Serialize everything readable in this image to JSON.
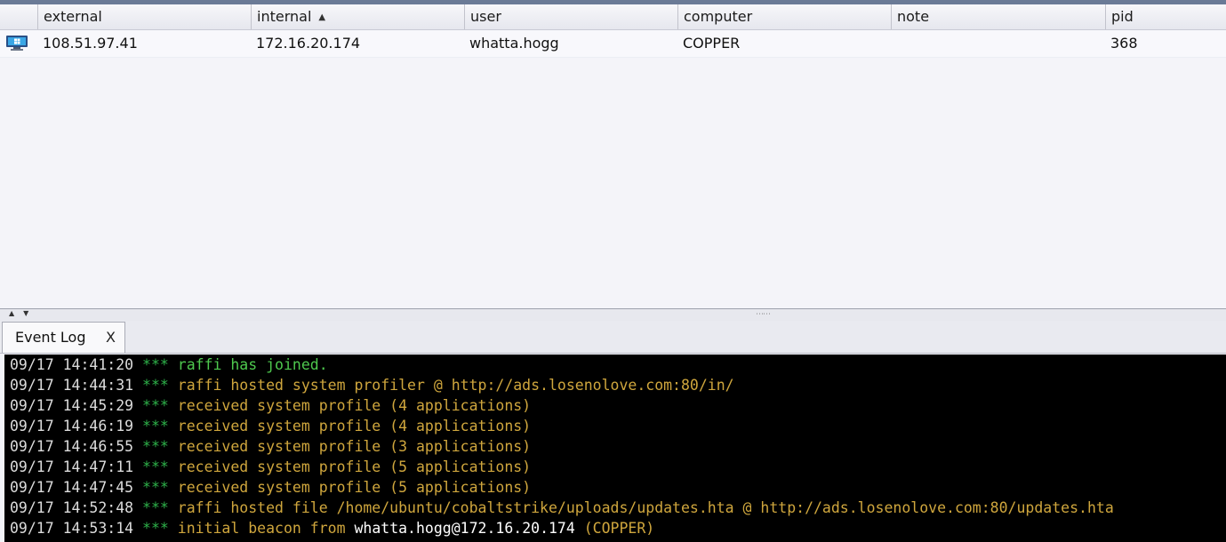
{
  "table": {
    "columns": [
      {
        "label": "external"
      },
      {
        "label": "internal",
        "sort": "▲"
      },
      {
        "label": "user"
      },
      {
        "label": "computer"
      },
      {
        "label": "note"
      },
      {
        "label": "pid"
      }
    ],
    "rows": [
      {
        "icon": "windows-monitor-icon",
        "external": "108.51.97.41",
        "internal": "172.16.20.174",
        "user": "whatta.hogg",
        "computer": "COPPER",
        "note": "",
        "pid": "368"
      }
    ]
  },
  "tabs": [
    {
      "label": "Event Log",
      "close": "X"
    }
  ],
  "event_log": [
    {
      "time": "09/17 14:41:20",
      "stars": "***",
      "msg": "raffi has joined.",
      "style": "green"
    },
    {
      "time": "09/17 14:44:31",
      "stars": "***",
      "msg": "raffi hosted system profiler @ http://ads.losenolove.com:80/in/",
      "style": "amber"
    },
    {
      "time": "09/17 14:45:29",
      "stars": "***",
      "msg": "received system profile (4 applications)",
      "style": "amber"
    },
    {
      "time": "09/17 14:46:19",
      "stars": "***",
      "msg": "received system profile (4 applications)",
      "style": "amber"
    },
    {
      "time": "09/17 14:46:55",
      "stars": "***",
      "msg": "received system profile (3 applications)",
      "style": "amber"
    },
    {
      "time": "09/17 14:47:11",
      "stars": "***",
      "msg": "received system profile (5 applications)",
      "style": "amber"
    },
    {
      "time": "09/17 14:47:45",
      "stars": "***",
      "msg": "received system profile (5 applications)",
      "style": "amber"
    },
    {
      "time": "09/17 14:52:48",
      "stars": "***",
      "msg": "raffi hosted file /home/ubuntu/cobaltstrike/uploads/updates.hta @ http://ads.losenolove.com:80/updates.hta",
      "style": "amber"
    },
    {
      "time": "09/17 14:53:14",
      "stars": "***",
      "msg_pre": "initial beacon from ",
      "msg_hl": "whatta.hogg@172.16.20.174",
      "msg_post": " (COPPER)",
      "style": "amber"
    }
  ],
  "colors": {
    "console_bg": "#000000",
    "timestamp": "#dcdcdc",
    "stars": "#2eb34a",
    "join_msg": "#4ec94e",
    "event_msg": "#cfa63d",
    "highlight": "#ffffff"
  }
}
